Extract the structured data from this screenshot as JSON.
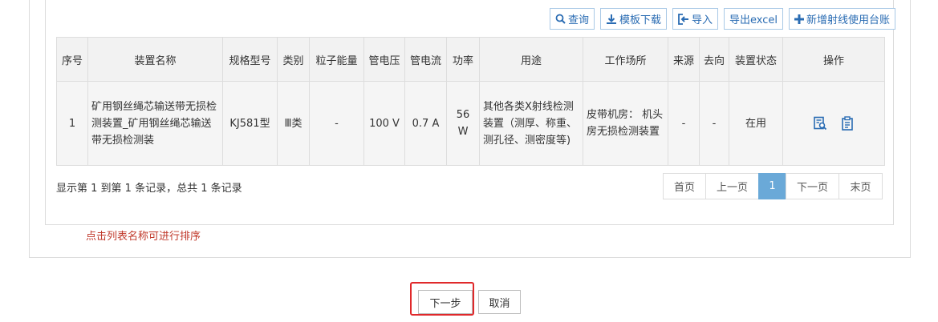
{
  "toolbar": {
    "query": "查询",
    "template_download": "模板下载",
    "import": "导入",
    "export": "导出excel",
    "add": "新增射线使用台账"
  },
  "table": {
    "headers": [
      "序号",
      "装置名称",
      "规格型号",
      "类别",
      "粒子能量",
      "管电压",
      "管电流",
      "功率",
      "用途",
      "工作场所",
      "来源",
      "去向",
      "装置状态",
      "操作"
    ],
    "rows": [
      {
        "index": "1",
        "name": "矿用钢丝绳芯输送带无损检测装置_矿用钢丝绳芯输送带无损检测装",
        "model": "KJ581型",
        "category": "Ⅲ类",
        "particle_energy": "-",
        "voltage": "100 V",
        "current": "0.7 A",
        "power": "56 W",
        "usage": "其他各类X射线检测装置（测厚、称重、测孔径、测密度等)",
        "location": "皮带机房： 机头房无损检测装置",
        "source": "-",
        "destination": "-",
        "status": "在用"
      }
    ]
  },
  "records_text": "显示第 1 到第 1 条记录，总共 1 条记录",
  "pager": {
    "first": "首页",
    "prev": "上一页",
    "current": "1",
    "next": "下一页",
    "last": "末页"
  },
  "sort_tip": "点击列表名称可进行排序",
  "footer": {
    "next_step": "下一步",
    "cancel": "取消"
  },
  "colors": {
    "accent": "#2a6cb3",
    "active_page": "#6aa9d8",
    "tip": "#c0392b",
    "highlight": "#e0292b"
  }
}
